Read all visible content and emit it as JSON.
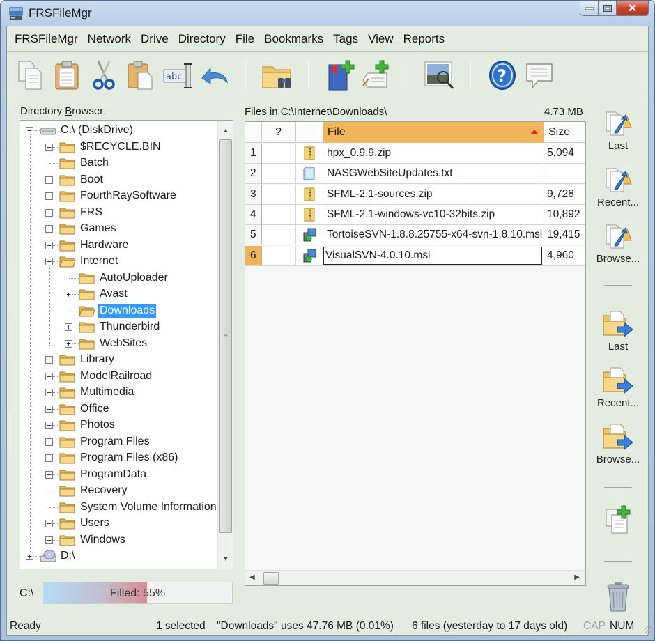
{
  "window": {
    "title": "FRSFileMgr",
    "icon": "monitor-icon",
    "controls": {
      "minimize": "minimize-icon",
      "maximize": "maximize-icon",
      "close": "close-icon"
    }
  },
  "menu": [
    "FRSFileMgr",
    "Network",
    "Drive",
    "Directory",
    "File",
    "Bookmarks",
    "Tags",
    "View",
    "Reports"
  ],
  "toolbar": {
    "groups": [
      [
        "copy-icon",
        "paste-icon",
        "cut-icon",
        "paste-special-icon",
        "rename-icon",
        "undo-icon"
      ],
      [
        "find-folder-icon"
      ],
      [
        "add-bookmark-icon",
        "add-tag-icon"
      ],
      [
        "image-preview-icon"
      ],
      [
        "help-icon",
        "feedback-icon"
      ]
    ]
  },
  "directory": {
    "label_pre": "Directory ",
    "label_underline": "B",
    "label_post": "rowser:",
    "tree": [
      {
        "label": "C:\\ (DiskDrive)",
        "level": 0,
        "expander": "minus",
        "icon": "drive-icon"
      },
      {
        "label": "$RECYCLE.BIN",
        "level": 1,
        "expander": "plus",
        "icon": "folder-icon"
      },
      {
        "label": "Batch",
        "level": 1,
        "expander": "none",
        "icon": "folder-icon"
      },
      {
        "label": "Boot",
        "level": 1,
        "expander": "plus",
        "icon": "folder-icon"
      },
      {
        "label": "FourthRaySoftware",
        "level": 1,
        "expander": "plus",
        "icon": "folder-icon"
      },
      {
        "label": "FRS",
        "level": 1,
        "expander": "plus",
        "icon": "folder-icon"
      },
      {
        "label": "Games",
        "level": 1,
        "expander": "plus",
        "icon": "folder-icon"
      },
      {
        "label": "Hardware",
        "level": 1,
        "expander": "plus",
        "icon": "folder-icon"
      },
      {
        "label": "Internet",
        "level": 1,
        "expander": "minus",
        "icon": "folder-open-icon"
      },
      {
        "label": "AutoUploader",
        "level": 2,
        "expander": "none",
        "icon": "folder-icon"
      },
      {
        "label": "Avast",
        "level": 2,
        "expander": "plus",
        "icon": "folder-icon"
      },
      {
        "label": "Downloads",
        "level": 2,
        "expander": "none",
        "icon": "folder-open-icon",
        "selected": true
      },
      {
        "label": "Thunderbird",
        "level": 2,
        "expander": "plus",
        "icon": "folder-icon"
      },
      {
        "label": "WebSites",
        "level": 2,
        "expander": "plus",
        "icon": "folder-icon"
      },
      {
        "label": "Library",
        "level": 1,
        "expander": "plus",
        "icon": "folder-icon"
      },
      {
        "label": "ModelRailroad",
        "level": 1,
        "expander": "plus",
        "icon": "folder-icon"
      },
      {
        "label": "Multimedia",
        "level": 1,
        "expander": "plus",
        "icon": "folder-icon"
      },
      {
        "label": "Office",
        "level": 1,
        "expander": "plus",
        "icon": "folder-icon"
      },
      {
        "label": "Photos",
        "level": 1,
        "expander": "plus",
        "icon": "folder-icon"
      },
      {
        "label": "Program Files",
        "level": 1,
        "expander": "plus",
        "icon": "folder-icon"
      },
      {
        "label": "Program Files (x86)",
        "level": 1,
        "expander": "plus",
        "icon": "folder-icon"
      },
      {
        "label": "ProgramData",
        "level": 1,
        "expander": "plus",
        "icon": "folder-icon"
      },
      {
        "label": "Recovery",
        "level": 1,
        "expander": "none",
        "icon": "folder-icon"
      },
      {
        "label": "System Volume Information",
        "level": 1,
        "expander": "none",
        "icon": "folder-icon"
      },
      {
        "label": "Users",
        "level": 1,
        "expander": "plus",
        "icon": "folder-icon"
      },
      {
        "label": "Windows",
        "level": 1,
        "expander": "plus",
        "icon": "folder-icon"
      },
      {
        "label": "D:\\",
        "level": 0,
        "expander": "plus",
        "icon": "optical-drive-icon"
      }
    ]
  },
  "disk": {
    "drive": "C:\\",
    "fill_label": "Filled: ",
    "fill_value": "55%",
    "fill_fraction": 0.55
  },
  "files": {
    "path_pre": "F",
    "path_underline": "i",
    "path_post": "les in C:\\Internet\\Downloads\\",
    "total_size": "4.73 MB",
    "columns": [
      "",
      "?",
      "",
      "File",
      "Size"
    ],
    "sort_column": "File",
    "rows": [
      {
        "num": "1",
        "icon": "zip-icon",
        "name": "hpx_0.9.9.zip",
        "size": "5,094"
      },
      {
        "num": "2",
        "icon": "text-file-icon",
        "name": "NASGWebSiteUpdates.txt",
        "size": ""
      },
      {
        "num": "3",
        "icon": "zip-icon",
        "name": "SFML-2.1-sources.zip",
        "size": "9,728"
      },
      {
        "num": "4",
        "icon": "zip-icon",
        "name": "SFML-2.1-windows-vc10-32bits.zip",
        "size": "10,892"
      },
      {
        "num": "5",
        "icon": "installer-icon",
        "name": "TortoiseSVN-1.8.8.25755-x64-svn-1.8.10.msi",
        "size": "19,415"
      },
      {
        "num": "6",
        "icon": "installer-icon",
        "name": "VisualSVN-4.0.10.msi",
        "size": "4,960",
        "current": true
      }
    ]
  },
  "side": {
    "open_group": [
      {
        "label": "Last",
        "icon": "open-file-icon"
      },
      {
        "label": "Recent...",
        "icon": "open-file-icon"
      },
      {
        "label": "Browse...",
        "icon": "open-file-icon"
      }
    ],
    "move_group": [
      {
        "label": "Last",
        "icon": "move-to-folder-icon"
      },
      {
        "label": "Recent...",
        "icon": "move-to-folder-icon"
      },
      {
        "label": "Browse...",
        "icon": "move-to-folder-icon"
      }
    ],
    "copy_new": {
      "icon": "copy-add-icon"
    },
    "trash": {
      "icon": "trash-icon"
    }
  },
  "status": {
    "ready": "Ready",
    "selected": "1 selected",
    "usage": "\"Downloads\" uses 47.76 MB (0.01%)",
    "files": "6 files (yesterday to 17 days old)",
    "cap": "CAP",
    "num": "NUM"
  }
}
